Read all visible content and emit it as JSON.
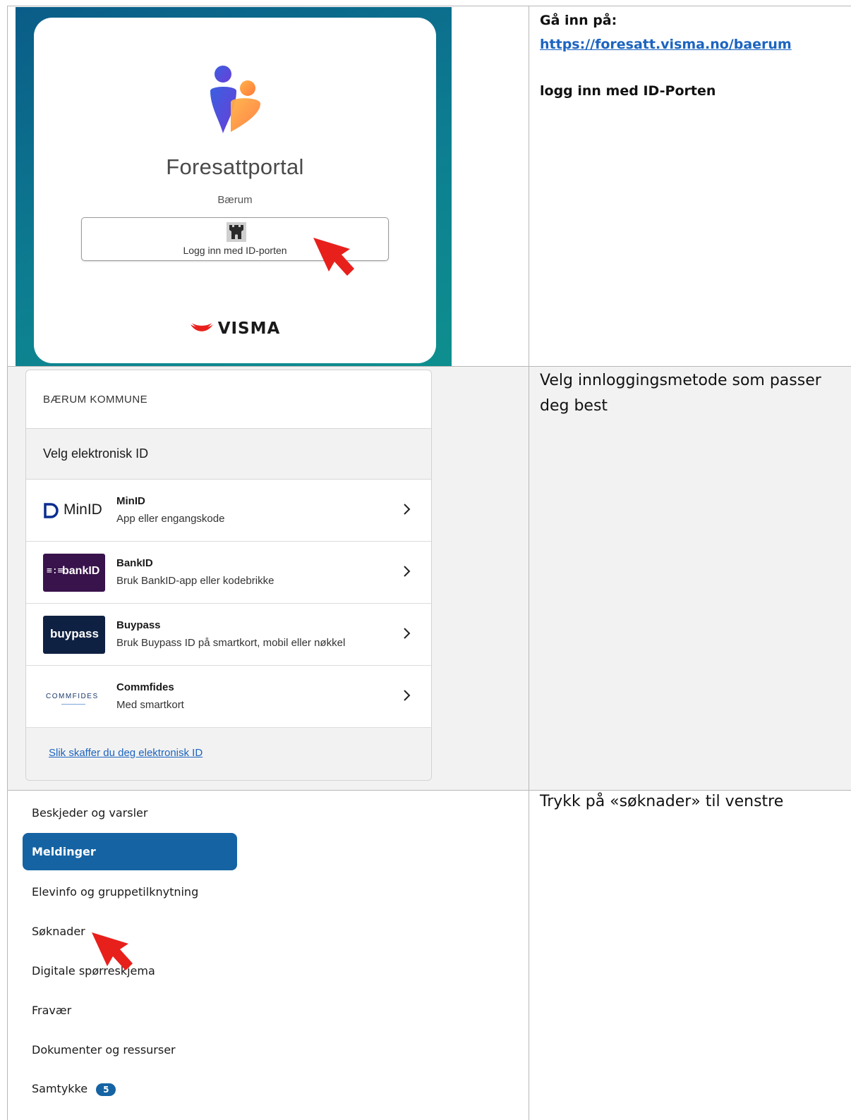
{
  "row1": {
    "portal_title": "Foresattportal",
    "portal_subtitle": "Bærum",
    "login_button_label": "Logg inn med ID-porten",
    "brand": "VISMA",
    "instruction_heading": "Gå inn på:",
    "instruction_link": "https://foresatt.visma.no/baerum",
    "instruction_note": "logg inn med ID-Porten"
  },
  "row2": {
    "org": "BÆRUM KOMMUNE",
    "choose_label": "Velg elektronisk ID",
    "methods": [
      {
        "logo": "MinID",
        "name": "MinID",
        "desc": "App eller engangskode"
      },
      {
        "logo": "bankID",
        "name": "BankID",
        "desc": "Bruk BankID-app eller kodebrikke"
      },
      {
        "logo": "buypass",
        "name": "Buypass",
        "desc": "Bruk Buypass ID på smartkort, mobil eller nøkkel"
      },
      {
        "logo": "COMMFIDES",
        "name": "Commfides",
        "desc": "Med smartkort"
      }
    ],
    "help_link": "Slik skaffer du deg elektronisk ID",
    "instruction": "Velg innloggingsmetode som passer deg best"
  },
  "row3": {
    "nav": [
      "Beskjeder og varsler",
      "Meldinger",
      "Elevinfo og gruppetilknytning",
      "Søknader",
      "Digitale spørreskjema",
      "Fravær",
      "Dokumenter og ressurser",
      "Samtykke"
    ],
    "samtykke_badge": "5",
    "instruction": "Trykk på «søknader» til venstre"
  },
  "colors": {
    "accent_blue": "#1563a3",
    "link_blue": "#1c64c0",
    "arrow_red": "#e8201c",
    "portal_teal": "#0d7e91"
  }
}
